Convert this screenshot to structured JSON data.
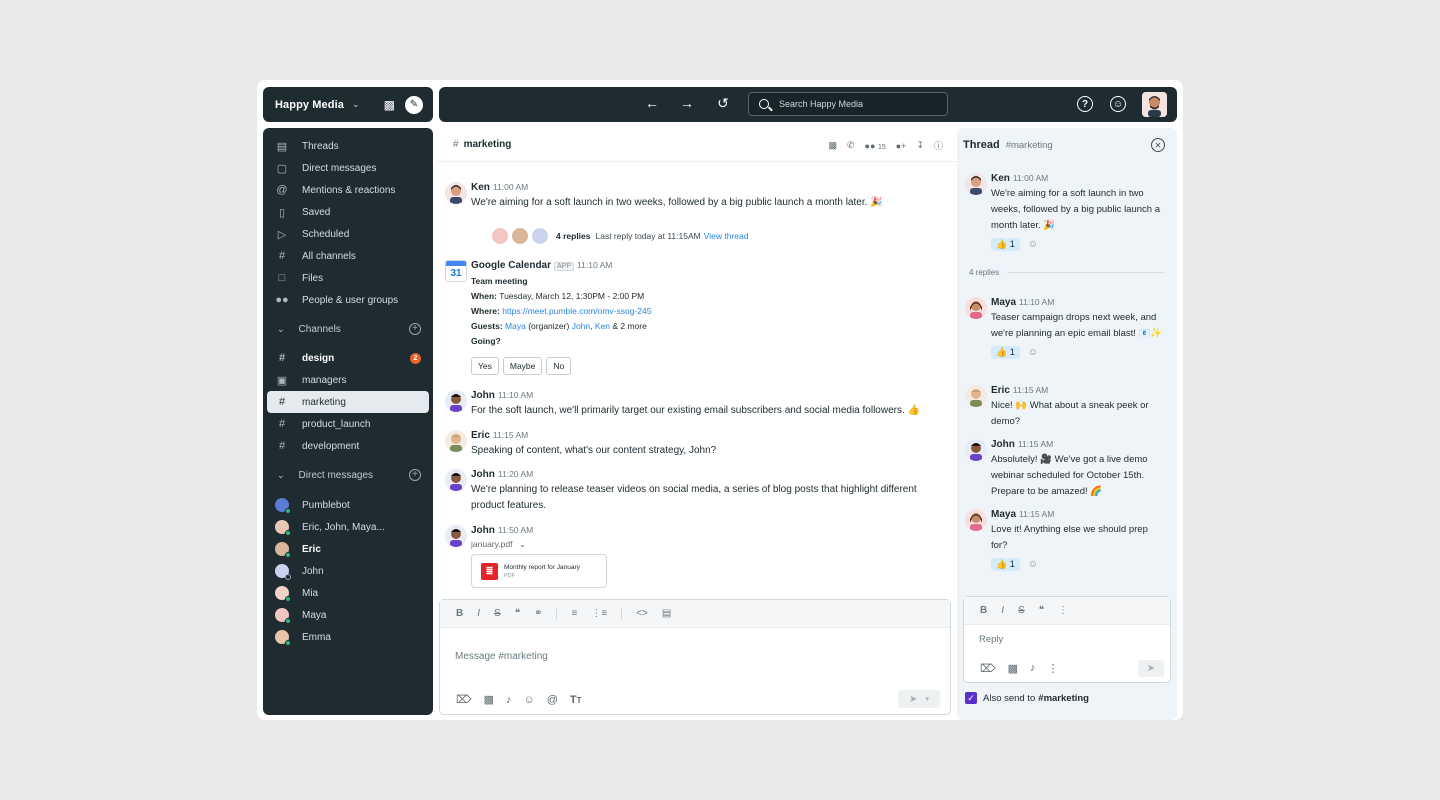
{
  "workspace": {
    "name": "Happy Media"
  },
  "search": {
    "placeholder": "Search Happy Media"
  },
  "sidebar": {
    "nav": [
      {
        "label": "Threads",
        "icon": "threads-icon"
      },
      {
        "label": "Direct messages",
        "icon": "direct-messages-icon"
      },
      {
        "label": "Mentions & reactions",
        "icon": "at-icon"
      },
      {
        "label": "Saved",
        "icon": "bookmark-icon"
      },
      {
        "label": "Scheduled",
        "icon": "scheduled-icon"
      },
      {
        "label": "All channels",
        "icon": "all-channels-icon"
      },
      {
        "label": "Files",
        "icon": "file-icon"
      },
      {
        "label": "People & user groups",
        "icon": "people-icon"
      }
    ],
    "channels_header": "Channels",
    "channels": [
      {
        "name": "design",
        "badge": "2"
      },
      {
        "name": "managers"
      },
      {
        "name": "marketing"
      },
      {
        "name": "product_launch"
      },
      {
        "name": "development"
      }
    ],
    "dm_header": "Direct messages",
    "dms": [
      "Pumblebot",
      "Eric, John, Maya...",
      "Eric",
      "John",
      "Mia",
      "Maya",
      "Emma"
    ]
  },
  "channel": {
    "name": "marketing",
    "member_count": "15",
    "messages": {
      "ken": {
        "author": "Ken",
        "time": "11:00 AM",
        "text": "We're aiming for a soft launch in two weeks, followed by a big public launch a month later. 🎉"
      },
      "replies": {
        "count": "4 replies",
        "last": "Last reply today at 11:15AM",
        "link": "View thread"
      },
      "gcal": {
        "author": "Google Calendar",
        "tag": "APP",
        "time": "11:10 AM",
        "date_num": "31",
        "event": "Team meeting",
        "when_label": "When:",
        "when": "Tuesday, March 12, 1:30PM - 2:00 PM",
        "where_label": "Where:",
        "where": "https://meet.pumble.com/omv-ssog-245",
        "guests_label": "Guests:",
        "guest1": "Maya",
        "guest1_note": "(organizer)",
        "guest2": "John",
        "guest3": "Ken",
        "guests_more": "& 2 more",
        "going": "Going?",
        "yes": "Yes",
        "maybe": "Maybe",
        "no": "No"
      },
      "john1": {
        "author": "John",
        "time": "11:10 AM",
        "text": "For the soft launch, we'll primarily target our existing email subscribers and social media followers. 👍"
      },
      "eric1": {
        "author": "Eric",
        "time": "11:15 AM",
        "text": "Speaking of content, what's our content strategy, John?"
      },
      "john2": {
        "author": "John",
        "time": "11:20 AM",
        "text": "We're planning to release teaser videos on social media, a series of blog posts that highlight different product features."
      },
      "john3": {
        "author": "John",
        "time": "11:50 AM",
        "file": "january.pdf",
        "card_title": "Monthly report for January",
        "card_type": "PDF"
      }
    },
    "composer_placeholder": "Message #marketing"
  },
  "thread": {
    "title": "Thread",
    "channel": "#marketing",
    "parent": {
      "author": "Ken",
      "time": "11:00 AM",
      "text": "We're aiming for a soft launch in two weeks, followed by a big public launch a month later. 🎉",
      "reaction": "👍 1"
    },
    "replies_label": "4 replies",
    "replies": [
      {
        "author": "Maya",
        "time": "11:10 AM",
        "text": "Teaser campaign drops next week, and we're planning an epic email blast! 📧✨",
        "reaction": "👍 1"
      },
      {
        "author": "Eric",
        "time": "11:15 AM",
        "text": "Nice! 🙌 What about a sneak peek or demo?"
      },
      {
        "author": "John",
        "time": "11:15 AM",
        "text": "Absolutely! 🎥 We've got a live demo webinar scheduled for October 15th. Prepare to be amazed! 🌈"
      },
      {
        "author": "Maya",
        "time": "11:15 AM",
        "text": "Love it! Anything else we should prep for?",
        "reaction": "👍 1"
      }
    ],
    "reply_placeholder": "Reply",
    "also_send_prefix": "Also send to",
    "also_send_channel": "#marketing"
  },
  "colors": {
    "dark": "#1e2b31",
    "accent_link": "#2b86e0",
    "badge": "#e8622b",
    "checkbox": "#5b2fc9",
    "reaction_bg": "#d3ebfb"
  }
}
